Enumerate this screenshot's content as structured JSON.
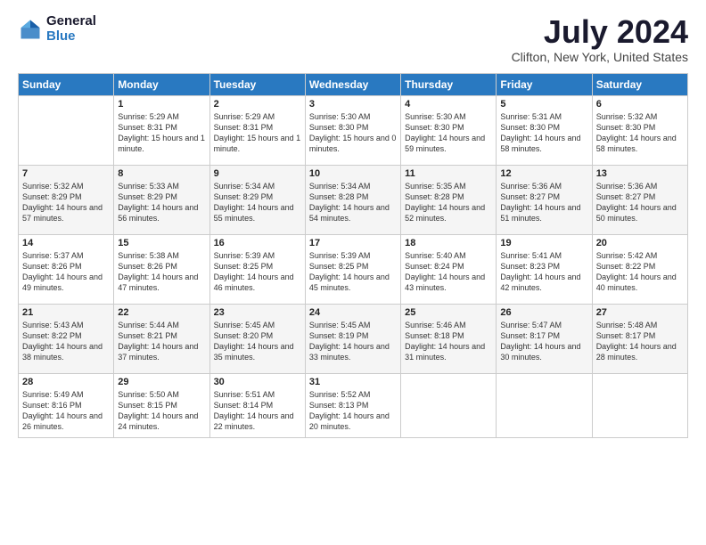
{
  "logo": {
    "general": "General",
    "blue": "Blue"
  },
  "header": {
    "title": "July 2024",
    "subtitle": "Clifton, New York, United States"
  },
  "columns": [
    "Sunday",
    "Monday",
    "Tuesday",
    "Wednesday",
    "Thursday",
    "Friday",
    "Saturday"
  ],
  "weeks": [
    [
      {
        "day": "",
        "sunrise": "",
        "sunset": "",
        "daylight": ""
      },
      {
        "day": "1",
        "sunrise": "Sunrise: 5:29 AM",
        "sunset": "Sunset: 8:31 PM",
        "daylight": "Daylight: 15 hours and 1 minute."
      },
      {
        "day": "2",
        "sunrise": "Sunrise: 5:29 AM",
        "sunset": "Sunset: 8:31 PM",
        "daylight": "Daylight: 15 hours and 1 minute."
      },
      {
        "day": "3",
        "sunrise": "Sunrise: 5:30 AM",
        "sunset": "Sunset: 8:30 PM",
        "daylight": "Daylight: 15 hours and 0 minutes."
      },
      {
        "day": "4",
        "sunrise": "Sunrise: 5:30 AM",
        "sunset": "Sunset: 8:30 PM",
        "daylight": "Daylight: 14 hours and 59 minutes."
      },
      {
        "day": "5",
        "sunrise": "Sunrise: 5:31 AM",
        "sunset": "Sunset: 8:30 PM",
        "daylight": "Daylight: 14 hours and 58 minutes."
      },
      {
        "day": "6",
        "sunrise": "Sunrise: 5:32 AM",
        "sunset": "Sunset: 8:30 PM",
        "daylight": "Daylight: 14 hours and 58 minutes."
      }
    ],
    [
      {
        "day": "7",
        "sunrise": "Sunrise: 5:32 AM",
        "sunset": "Sunset: 8:29 PM",
        "daylight": "Daylight: 14 hours and 57 minutes."
      },
      {
        "day": "8",
        "sunrise": "Sunrise: 5:33 AM",
        "sunset": "Sunset: 8:29 PM",
        "daylight": "Daylight: 14 hours and 56 minutes."
      },
      {
        "day": "9",
        "sunrise": "Sunrise: 5:34 AM",
        "sunset": "Sunset: 8:29 PM",
        "daylight": "Daylight: 14 hours and 55 minutes."
      },
      {
        "day": "10",
        "sunrise": "Sunrise: 5:34 AM",
        "sunset": "Sunset: 8:28 PM",
        "daylight": "Daylight: 14 hours and 54 minutes."
      },
      {
        "day": "11",
        "sunrise": "Sunrise: 5:35 AM",
        "sunset": "Sunset: 8:28 PM",
        "daylight": "Daylight: 14 hours and 52 minutes."
      },
      {
        "day": "12",
        "sunrise": "Sunrise: 5:36 AM",
        "sunset": "Sunset: 8:27 PM",
        "daylight": "Daylight: 14 hours and 51 minutes."
      },
      {
        "day": "13",
        "sunrise": "Sunrise: 5:36 AM",
        "sunset": "Sunset: 8:27 PM",
        "daylight": "Daylight: 14 hours and 50 minutes."
      }
    ],
    [
      {
        "day": "14",
        "sunrise": "Sunrise: 5:37 AM",
        "sunset": "Sunset: 8:26 PM",
        "daylight": "Daylight: 14 hours and 49 minutes."
      },
      {
        "day": "15",
        "sunrise": "Sunrise: 5:38 AM",
        "sunset": "Sunset: 8:26 PM",
        "daylight": "Daylight: 14 hours and 47 minutes."
      },
      {
        "day": "16",
        "sunrise": "Sunrise: 5:39 AM",
        "sunset": "Sunset: 8:25 PM",
        "daylight": "Daylight: 14 hours and 46 minutes."
      },
      {
        "day": "17",
        "sunrise": "Sunrise: 5:39 AM",
        "sunset": "Sunset: 8:25 PM",
        "daylight": "Daylight: 14 hours and 45 minutes."
      },
      {
        "day": "18",
        "sunrise": "Sunrise: 5:40 AM",
        "sunset": "Sunset: 8:24 PM",
        "daylight": "Daylight: 14 hours and 43 minutes."
      },
      {
        "day": "19",
        "sunrise": "Sunrise: 5:41 AM",
        "sunset": "Sunset: 8:23 PM",
        "daylight": "Daylight: 14 hours and 42 minutes."
      },
      {
        "day": "20",
        "sunrise": "Sunrise: 5:42 AM",
        "sunset": "Sunset: 8:22 PM",
        "daylight": "Daylight: 14 hours and 40 minutes."
      }
    ],
    [
      {
        "day": "21",
        "sunrise": "Sunrise: 5:43 AM",
        "sunset": "Sunset: 8:22 PM",
        "daylight": "Daylight: 14 hours and 38 minutes."
      },
      {
        "day": "22",
        "sunrise": "Sunrise: 5:44 AM",
        "sunset": "Sunset: 8:21 PM",
        "daylight": "Daylight: 14 hours and 37 minutes."
      },
      {
        "day": "23",
        "sunrise": "Sunrise: 5:45 AM",
        "sunset": "Sunset: 8:20 PM",
        "daylight": "Daylight: 14 hours and 35 minutes."
      },
      {
        "day": "24",
        "sunrise": "Sunrise: 5:45 AM",
        "sunset": "Sunset: 8:19 PM",
        "daylight": "Daylight: 14 hours and 33 minutes."
      },
      {
        "day": "25",
        "sunrise": "Sunrise: 5:46 AM",
        "sunset": "Sunset: 8:18 PM",
        "daylight": "Daylight: 14 hours and 31 minutes."
      },
      {
        "day": "26",
        "sunrise": "Sunrise: 5:47 AM",
        "sunset": "Sunset: 8:17 PM",
        "daylight": "Daylight: 14 hours and 30 minutes."
      },
      {
        "day": "27",
        "sunrise": "Sunrise: 5:48 AM",
        "sunset": "Sunset: 8:17 PM",
        "daylight": "Daylight: 14 hours and 28 minutes."
      }
    ],
    [
      {
        "day": "28",
        "sunrise": "Sunrise: 5:49 AM",
        "sunset": "Sunset: 8:16 PM",
        "daylight": "Daylight: 14 hours and 26 minutes."
      },
      {
        "day": "29",
        "sunrise": "Sunrise: 5:50 AM",
        "sunset": "Sunset: 8:15 PM",
        "daylight": "Daylight: 14 hours and 24 minutes."
      },
      {
        "day": "30",
        "sunrise": "Sunrise: 5:51 AM",
        "sunset": "Sunset: 8:14 PM",
        "daylight": "Daylight: 14 hours and 22 minutes."
      },
      {
        "day": "31",
        "sunrise": "Sunrise: 5:52 AM",
        "sunset": "Sunset: 8:13 PM",
        "daylight": "Daylight: 14 hours and 20 minutes."
      },
      {
        "day": "",
        "sunrise": "",
        "sunset": "",
        "daylight": ""
      },
      {
        "day": "",
        "sunrise": "",
        "sunset": "",
        "daylight": ""
      },
      {
        "day": "",
        "sunrise": "",
        "sunset": "",
        "daylight": ""
      }
    ]
  ]
}
